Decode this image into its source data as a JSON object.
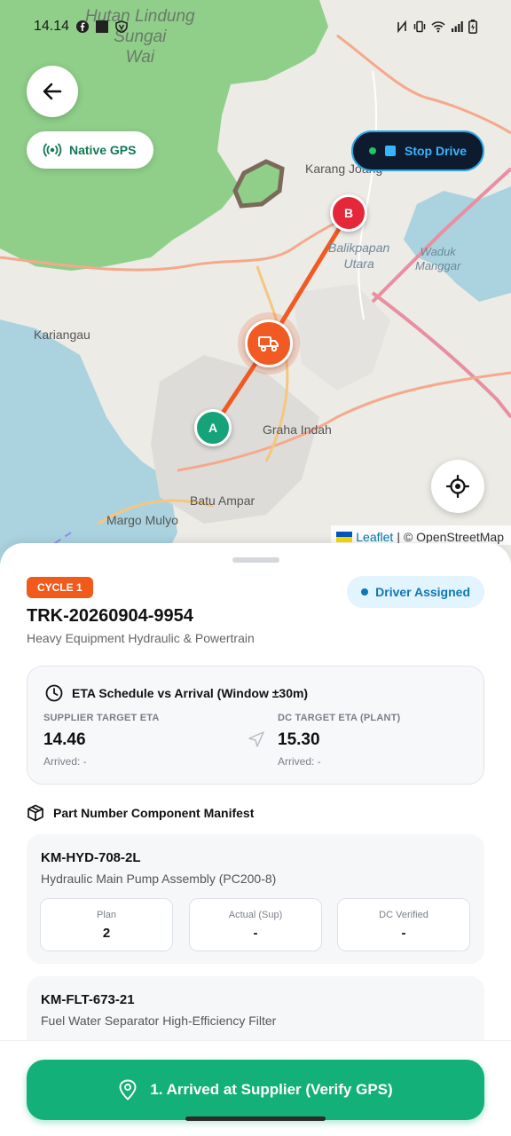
{
  "status_bar": {
    "time": "14.14"
  },
  "map": {
    "gps_mode_label": "Native GPS",
    "stop_drive_label": "Stop Drive",
    "labels": {
      "forest": "Hutan Lindung\nSungai\nWai",
      "karang_joang": "Karang Joang",
      "balikpapan_utara": "Balikpapan\nUtara",
      "waduk_manggar": "Waduk\nManggar",
      "kariangau": "Kariangau",
      "graha_indah": "Graha Indah",
      "batu_ampar": "Batu Ampar",
      "margo_mulyo": "Margo Mulyo"
    },
    "marker_a": "A",
    "marker_b": "B",
    "attribution_link": "Leaflet",
    "attribution_sep": "|",
    "attribution_text": "© OpenStreetMap",
    "colors": {
      "route": "#f15a22",
      "marker_a": "#16a37a",
      "marker_b": "#e4283a",
      "truck": "#f15a22"
    }
  },
  "trip": {
    "cycle_label": "CYCLE 1",
    "status_label": "Driver Assigned",
    "truck_id": "TRK-20260904-9954",
    "cargo": "Heavy Equipment Hydraulic & Powertrain"
  },
  "eta": {
    "title": "ETA Schedule vs Arrival (Window ±30m)",
    "supplier": {
      "label": "SUPPLIER TARGET ETA",
      "value": "14.46",
      "arrived": "Arrived: -"
    },
    "dc": {
      "label": "DC TARGET ETA (PLANT)",
      "value": "15.30",
      "arrived": "Arrived: -"
    }
  },
  "manifest": {
    "title": "Part Number Component Manifest",
    "columns": [
      "Plan",
      "Actual (Sup)",
      "DC Verified"
    ],
    "parts": [
      {
        "number": "KM-HYD-708-2L",
        "description": "Hydraulic Main Pump Assembly (PC200-8)",
        "plan": "2",
        "actual": "-",
        "verified": "-"
      },
      {
        "number": "KM-FLT-673-21",
        "description": "Fuel Water Separator High-Efficiency Filter"
      }
    ]
  },
  "action": {
    "primary_label": "1. Arrived at Supplier (Verify GPS)",
    "color": "#13b07a"
  }
}
